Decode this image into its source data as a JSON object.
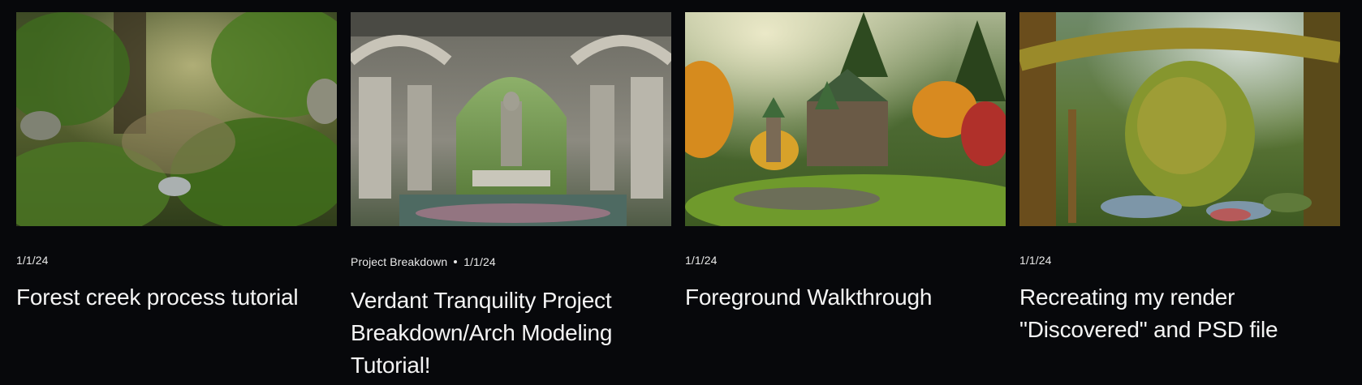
{
  "cards": [
    {
      "category": "",
      "date": "1/1/24",
      "title": "Forest creek process tutorial",
      "thumbnail": "forest-creek-render"
    },
    {
      "category": "Project Breakdown",
      "date": "1/1/24",
      "title": "Verdant Tranquility Project Breakdown/Arch Modeling Tutorial!",
      "thumbnail": "ruined-arch-pool-render"
    },
    {
      "category": "",
      "date": "1/1/24",
      "title": "Foreground Walkthrough",
      "thumbnail": "autumn-castle-render"
    },
    {
      "category": "",
      "date": "1/1/24",
      "title": "Recreating my render \"Discovered\" and PSD file",
      "thumbnail": "mossy-forest-render"
    }
  ],
  "colors": {
    "background": "#07080b",
    "text": "#f4f4f4"
  }
}
